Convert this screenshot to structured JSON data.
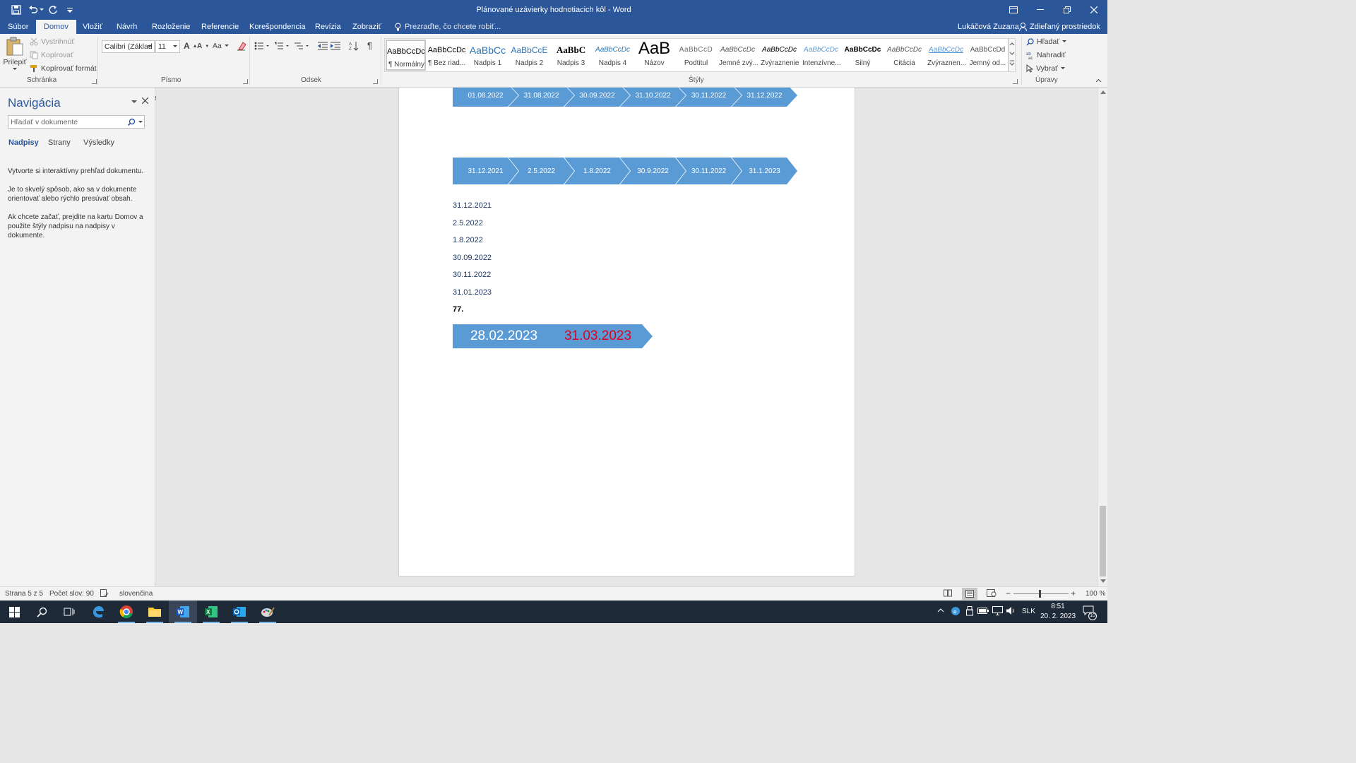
{
  "window": {
    "title": "Plánované uzávierky hodnotiacich kôl - Word"
  },
  "tabs": [
    {
      "label": "Súbor"
    },
    {
      "label": "Domov"
    },
    {
      "label": "Vložiť"
    },
    {
      "label": "Návrh"
    },
    {
      "label": "Rozloženie"
    },
    {
      "label": "Referencie"
    },
    {
      "label": "Korešpondencia"
    },
    {
      "label": "Revízia"
    },
    {
      "label": "Zobraziť"
    }
  ],
  "tell_me": {
    "placeholder": "Prezraďte, čo chcete robiť..."
  },
  "account": {
    "user": "Lukáčová Zuzana",
    "share_label": "Zdieľaný prostriedok"
  },
  "clipboard": {
    "paste": "Prilepiť",
    "cut": "Vystrihnúť",
    "copy": "Kopírovať",
    "format_painter": "Kopírovať formát",
    "group": "Schránka"
  },
  "font": {
    "name": "Calibri (Základ",
    "size": "11",
    "case_label": "Aa",
    "group": "Písmo"
  },
  "paragraph": {
    "group": "Odsek"
  },
  "styles": {
    "group": "Štýly",
    "items": [
      {
        "preview": "AaBbCcDc",
        "name": "¶ Normálny"
      },
      {
        "preview": "AaBbCcDc",
        "name": "¶ Bez riad..."
      },
      {
        "preview": "AaBbCc",
        "name": "Nadpis 1"
      },
      {
        "preview": "AaBbCcE",
        "name": "Nadpis 2"
      },
      {
        "preview": "AaBbC",
        "name": "Nadpis 3"
      },
      {
        "preview": "AaBbCcDc",
        "name": "Nadpis 4"
      },
      {
        "preview": "AaB",
        "name": "Názov"
      },
      {
        "preview": "AaBbCcD",
        "name": "Podtitul"
      },
      {
        "preview": "AaBbCcDc",
        "name": "Jemné zvý..."
      },
      {
        "preview": "AaBbCcDc",
        "name": "Zvýraznenie"
      },
      {
        "preview": "AaBbCcDc",
        "name": "Intenzívne..."
      },
      {
        "preview": "AaBbCcDc",
        "name": "Silný"
      },
      {
        "preview": "AaBbCcDc",
        "name": "Citácia"
      },
      {
        "preview": "AaBbCcDc",
        "name": "Zvýraznen..."
      },
      {
        "preview": "AaBbCcDd",
        "name": "Jemný od..."
      }
    ]
  },
  "editing": {
    "find": "Hľadať",
    "replace": "Nahradiť",
    "select": "Vybrať",
    "group": "Úpravy"
  },
  "navigation": {
    "title": "Navigácia",
    "search_placeholder": "Hľadať v dokumente",
    "tabs": [
      "Nadpisy",
      "Strany",
      "Výsledky"
    ],
    "text1": "Vytvorte si interaktívny prehľad dokumentu.",
    "text2": "Je to skvelý spôsob, ako sa v dokumente orientovať alebo rýchlo presúvať obsah.",
    "text3": "Ak chcete začať, prejdite na kartu Domov a použite štýly nadpisu na nadpisy v dokumente."
  },
  "document": {
    "process_row1": [
      "01.08.2022",
      "31.08.2022",
      "30.09.2022",
      "31.10.2022",
      "30.11.2022",
      "31.12.2022"
    ],
    "process_row2": [
      "31.12.2021",
      "2.5.2022",
      "1.8.2022",
      "30.9.2022",
      "30.11.2022",
      "31.1.2023"
    ],
    "date_list": [
      "31.12.2021",
      "2.5.2022",
      "1.8.2022",
      "30.09.2022",
      "30.11.2022",
      "31.01.2023"
    ],
    "bold_number": "77.",
    "final_dates": [
      "28.02.2023",
      "31.03.2023"
    ]
  },
  "colors": {
    "accent": "#2b579a",
    "chevron": "#5b9bd5",
    "red_date": "#e0001b"
  },
  "status": {
    "page": "Strana 5 z 5",
    "words": "Počet slov: 90",
    "language": "slovenčina",
    "zoom": "100 %"
  },
  "taskbar": {
    "lang": "SLK",
    "time": "8:51",
    "date": "20. 2. 2023",
    "notifications": "10"
  }
}
